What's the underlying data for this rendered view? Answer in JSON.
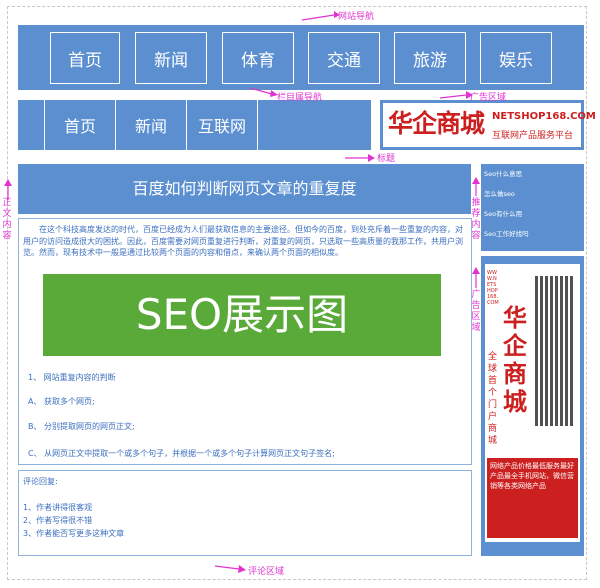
{
  "labels": {
    "site_nav": "网站导航",
    "sub_nav": "栏目属导航",
    "ad_area": "广告区域",
    "title": "标题",
    "main_content": "正文内容",
    "recommend": "推荐内容",
    "ad_area_2": "广告区域",
    "comment_area": "评论区域"
  },
  "nav": [
    "首页",
    "新闻",
    "体育",
    "交通",
    "旅游",
    "娱乐"
  ],
  "subnav": [
    "首页",
    "新闻",
    "互联网"
  ],
  "ad": {
    "logo_text": "华企商城",
    "domain": "NETSHOP168.COM",
    "tagline": "互联网产品服务平台"
  },
  "article": {
    "title": "百度如何判断网页文章的重复度",
    "paragraph": "在这个科技高度发达的时代，百度已经成为人们最获取信息的主要途径。但如今的百度，到处充斥着一些重复的内容，对用户的访问造成很大的困扰。因此，百度需要对网页重复进行判断，对重复的网页，只选取一些高质量的我那工作，共用户浏览。然而，现有技术中一般是通过比较两个页面的内容和借点，来确认两个页面的相似度。",
    "image_text": "SEO展示图",
    "steps": [
      "1、  网站重复内容的判断",
      "A、  获取多个网页;",
      "B、  分别提取网页的网页正文;",
      "C、  从网页正文中提取一个或多个句子，并根据一个或多个句子计算网页正文句子签名;"
    ]
  },
  "recommend_list": [
    "Seo什么意思",
    "怎么做seo",
    "Seo有什么用",
    "Seo工作好找吗"
  ],
  "side_ad": {
    "domain": "WWW.NETSHOP168.COM",
    "vertical": "华企商城",
    "slogan": "全球首个门户商城",
    "bottom": "网络产品价格最低服务最好产品最全手机网站，微信营销等各类网络产品"
  },
  "comments": {
    "heading": "评论回复:",
    "items": [
      "1、作者讲得很客观",
      "2、作者写得很不错",
      "3、作者能否写更多这种文章"
    ]
  },
  "colors": {
    "nav_blue": "#5b8fd0",
    "annotation": "#e033d0",
    "ad_red": "#cc1f1f",
    "seo_green": "#5aaa3a"
  }
}
